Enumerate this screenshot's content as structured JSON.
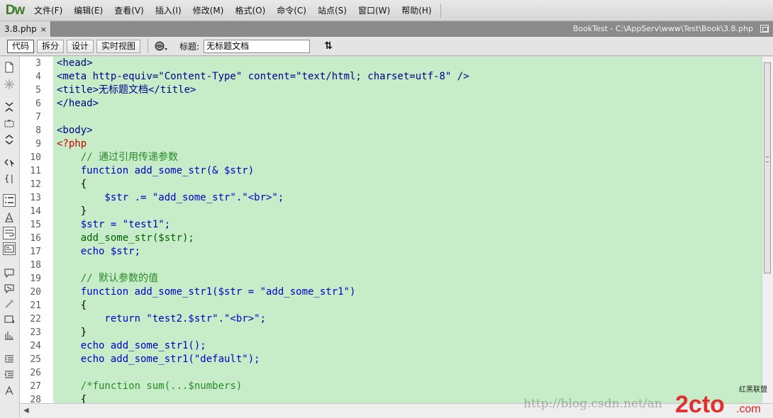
{
  "app": {
    "logo": "Dw"
  },
  "menu": [
    "文件(F)",
    "编辑(E)",
    "查看(V)",
    "插入(I)",
    "修改(M)",
    "格式(O)",
    "命令(C)",
    "站点(S)",
    "窗口(W)",
    "帮助(H)"
  ],
  "document": {
    "tab_name": "3.8.php",
    "close_glyph": "×",
    "path": "BookTest - C:\\AppServ\\www\\Test\\Book\\3.8.php"
  },
  "doc_toolbar": {
    "views": [
      "代码",
      "拆分",
      "设计",
      "实时视图"
    ],
    "active_view": "代码",
    "title_label": "标题:",
    "title_value": "无标题文档",
    "sort_glyph": "⇅"
  },
  "gutter": {
    "line_numbers": [
      "3",
      "4",
      "5",
      "6",
      "7",
      "8",
      "9",
      "10",
      "11",
      "12",
      "13",
      "14",
      "15",
      "16",
      "17",
      "18",
      "19",
      "20",
      "21",
      "22",
      "23",
      "24",
      "25",
      "26",
      "27",
      "28"
    ]
  },
  "code_lines": [
    "<head>",
    "<meta http-equiv=\"Content-Type\" content=\"text/html; charset=utf-8\" />",
    "<title>无标题文档</title>",
    "</head>",
    "",
    "<body>",
    "<?php",
    "    // 通过引用传递参数",
    "    function add_some_str(& $str)",
    "    {",
    "        $str .= \"add_some_str\".\"<br>\";",
    "    }",
    "    $str = \"test1\";",
    "    add_some_str($str);",
    "    echo $str;",
    "",
    "    // 默认参数的值",
    "    function add_some_str1($str = \"add_some_str1\")",
    "    {",
    "        return \"test2.$str\".\"<br>\";",
    "    }",
    "    echo add_some_str1();",
    "    echo add_some_str1(\"default\");",
    "",
    "    /*function sum(...$numbers)",
    "    {"
  ],
  "watermark": {
    "url": "http://blog.csdn.net/an",
    "logo_text": "2cto",
    "logo_suffix": ".com",
    "logo_top": "红黑联盟"
  },
  "colors": {
    "code_background": "#c6ecc8",
    "tag": "#00008b",
    "php_tag": "#d00000",
    "comment": "#2a8a2a",
    "keyword": "#0000cc",
    "function": "#006000"
  }
}
